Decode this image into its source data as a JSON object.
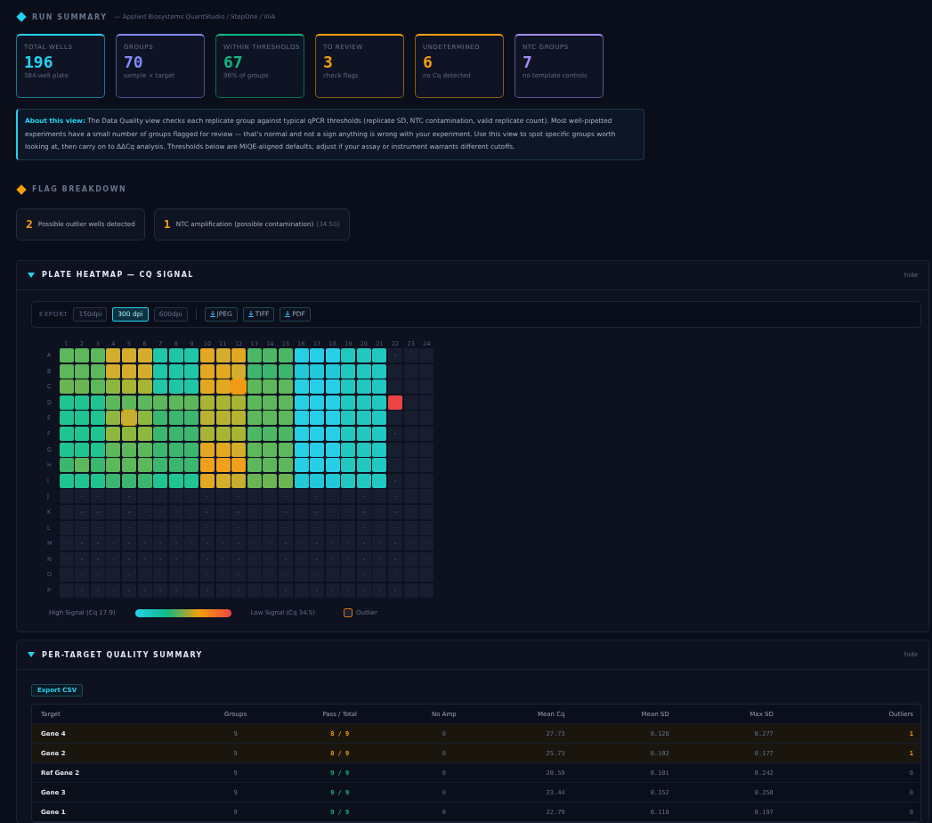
{
  "run_summary": {
    "title": "RUN SUMMARY",
    "subtitle": "— Applied Biosystems QuantStudio / StepOne / ViiA",
    "cards": [
      {
        "label": "TOTAL WELLS",
        "value": "196",
        "note": "384-well plate",
        "color": "#22d3ee"
      },
      {
        "label": "GROUPS",
        "value": "70",
        "note": "sample × target",
        "color": "#818cf8"
      },
      {
        "label": "WITHIN THRESHOLDS",
        "value": "67",
        "note": "96% of groups",
        "color": "#10b981"
      },
      {
        "label": "TO REVIEW",
        "value": "3",
        "note": "check flags",
        "color": "#f59e0b"
      },
      {
        "label": "UNDETERMINED",
        "value": "6",
        "note": "no Cq detected",
        "color": "#f59e0b"
      },
      {
        "label": "NTC GROUPS",
        "value": "7",
        "note": "no template controls",
        "color": "#a78bfa"
      }
    ],
    "about": "**About this view:** The Data Quality view checks each replicate group against typical qPCR thresholds (replicate SD, NTC contamination, valid replicate count). Most well-pipetted experiments have a small number of groups flagged for review — that's normal and not a sign anything is wrong with your experiment. Use this view to spot specific groups worth looking at, then carry on to ΔΔCq analysis. Thresholds below are MIQE-aligned defaults; adjust if your assay or instrument warrants different cutoffs."
  },
  "flag_breakdown": {
    "title": "FLAG BREAKDOWN",
    "flags": [
      {
        "count": "2",
        "text": "Possible outlier wells detected"
      },
      {
        "count": "1",
        "text": "NTC amplification (possible contamination)",
        "detail": "(34.50)"
      }
    ]
  },
  "heatmap": {
    "title": "PLATE HEATMAP — CQ SIGNAL",
    "toggle": "hide",
    "expanded": true,
    "export": {
      "label": "EXPORT",
      "resolutions": [
        {
          "label": "150dpi",
          "selected": false
        },
        {
          "label": "300 dpi",
          "selected": true
        },
        {
          "label": "600dpi",
          "selected": false
        }
      ],
      "formats": [
        "JPEG",
        "TIFF",
        "PDF"
      ]
    },
    "columns": [
      "1",
      "2",
      "3",
      "4",
      "5",
      "6",
      "7",
      "8",
      "9",
      "10",
      "11",
      "12",
      "13",
      "14",
      "15",
      "16",
      "17",
      "18",
      "19",
      "20",
      "21",
      "22",
      "23",
      "24"
    ],
    "rows": [
      {
        "label": "A",
        "wells": [
          {
            "color": "#5cb85a",
            "outlier": false
          },
          {
            "color": "#5cb85a",
            "outlier": false
          },
          {
            "color": "#5cb85a",
            "outlier": false
          },
          {
            "color": "#d4ad2c",
            "outlier": false
          },
          {
            "color": "#d4ad2c",
            "outlier": false
          },
          {
            "color": "#d4ad2c",
            "outlier": false
          },
          {
            "color": "#1fc7a8",
            "outlier": false
          },
          {
            "color": "#1fc7a8",
            "outlier": false
          },
          {
            "color": "#1fc7a8",
            "outlier": false
          },
          {
            "color": "#e3a822",
            "outlier": false
          },
          {
            "color": "#d4ad2c",
            "outlier": false
          },
          {
            "color": "#e3a822",
            "outlier": false
          },
          {
            "color": "#4cb866",
            "outlier": false
          },
          {
            "color": "#4cb866",
            "outlier": false
          },
          {
            "color": "#4cb866",
            "outlier": false
          },
          {
            "color": "#26cfe6",
            "outlier": false
          },
          {
            "color": "#26cfe6",
            "outlier": false
          },
          {
            "color": "#26cfe6",
            "outlier": false
          },
          {
            "color": "#20c8bf",
            "outlier": false
          },
          {
            "color": "#20c8bf",
            "outlier": false
          },
          {
            "color": "#20c8bf",
            "outlier": false
          }
        ]
      },
      {
        "label": "B",
        "wells": [
          {
            "color": "#5cb85a",
            "outlier": false
          },
          {
            "color": "#5cb85a",
            "outlier": false
          },
          {
            "color": "#5cb85a",
            "outlier": false
          },
          {
            "color": "#d4ad2c",
            "outlier": false
          },
          {
            "color": "#d4ad2c",
            "outlier": false
          },
          {
            "color": "#d4ad2c",
            "outlier": false
          },
          {
            "color": "#1fc7a8",
            "outlier": false
          },
          {
            "color": "#1fc7a8",
            "outlier": false
          },
          {
            "color": "#1fc7a8",
            "outlier": false
          },
          {
            "color": "#e3a822",
            "outlier": false
          },
          {
            "color": "#e3a822",
            "outlier": false
          },
          {
            "color": "#d4ad2c",
            "outlier": false
          },
          {
            "color": "#3cb56e",
            "outlier": false
          },
          {
            "color": "#3cb56e",
            "outlier": false
          },
          {
            "color": "#3cb56e",
            "outlier": false
          },
          {
            "color": "#20c8d8",
            "outlier": false
          },
          {
            "color": "#20c8d8",
            "outlier": false
          },
          {
            "color": "#20c8d8",
            "outlier": false
          },
          {
            "color": "#20c8bf",
            "outlier": false
          },
          {
            "color": "#20c8bf",
            "outlier": false
          },
          {
            "color": "#20c8bf",
            "outlier": false
          }
        ]
      },
      {
        "label": "C",
        "wells": [
          {
            "color": "#6ab552",
            "outlier": false
          },
          {
            "color": "#6ab552",
            "outlier": false
          },
          {
            "color": "#5cb85a",
            "outlier": false
          },
          {
            "color": "#8cb840",
            "outlier": false
          },
          {
            "color": "#a8b436",
            "outlier": false
          },
          {
            "color": "#a8b436",
            "outlier": false
          },
          {
            "color": "#1fc7a8",
            "outlier": false
          },
          {
            "color": "#1fc7a8",
            "outlier": false
          },
          {
            "color": "#1fc7a8",
            "outlier": false
          },
          {
            "color": "#e3a822",
            "outlier": false
          },
          {
            "color": "#e3a822",
            "outlier": false
          },
          {
            "color": "#f29a18",
            "outlier": true
          },
          {
            "color": "#5cb85a",
            "outlier": false
          },
          {
            "color": "#5cb85a",
            "outlier": false
          },
          {
            "color": "#5cb85a",
            "outlier": false
          },
          {
            "color": "#26cfe6",
            "outlier": false
          },
          {
            "color": "#26cfe6",
            "outlier": false
          },
          {
            "color": "#26cfe6",
            "outlier": false
          },
          {
            "color": "#20c8bf",
            "outlier": false
          },
          {
            "color": "#20c8bf",
            "outlier": false
          },
          {
            "color": "#20c8bf",
            "outlier": false
          }
        ]
      },
      {
        "label": "D",
        "wells": [
          {
            "color": "#1fc490",
            "outlier": false
          },
          {
            "color": "#1fc490",
            "outlier": false
          },
          {
            "color": "#1fc490",
            "outlier": false
          },
          {
            "color": "#5cb85a",
            "outlier": false
          },
          {
            "color": "#5cb85a",
            "outlier": false
          },
          {
            "color": "#5cb85a",
            "outlier": false
          },
          {
            "color": "#5cb85a",
            "outlier": false
          },
          {
            "color": "#5cb85a",
            "outlier": false
          },
          {
            "color": "#5cb85a",
            "outlier": false
          },
          {
            "color": "#a8b436",
            "outlier": false
          },
          {
            "color": "#a8b436",
            "outlier": false
          },
          {
            "color": "#a8b436",
            "outlier": false
          },
          {
            "color": "#5cb85a",
            "outlier": false
          },
          {
            "color": "#5cb85a",
            "outlier": false
          },
          {
            "color": "#5cb85a",
            "outlier": false
          },
          {
            "color": "#26cfe6",
            "outlier": false
          },
          {
            "color": "#26cfe6",
            "outlier": false
          },
          {
            "color": "#26cfe6",
            "outlier": false
          },
          {
            "color": "#20c8bf",
            "outlier": false
          },
          {
            "color": "#20c8bf",
            "outlier": false
          },
          {
            "color": "#20c8bf",
            "outlier": false
          },
          {
            "color": "#ef4444",
            "outlier": false
          }
        ]
      },
      {
        "label": "E",
        "wells": [
          {
            "color": "#1fc490",
            "outlier": false
          },
          {
            "color": "#1fc490",
            "outlier": false
          },
          {
            "color": "#1fc490",
            "outlier": false
          },
          {
            "color": "#8cb840",
            "outlier": false
          },
          {
            "color": "#c8ae2e",
            "outlier": true
          },
          {
            "color": "#8cb840",
            "outlier": false
          },
          {
            "color": "#3cb56e",
            "outlier": false
          },
          {
            "color": "#3cb56e",
            "outlier": false
          },
          {
            "color": "#3cb56e",
            "outlier": false
          },
          {
            "color": "#b8b232",
            "outlier": false
          },
          {
            "color": "#b8b232",
            "outlier": false
          },
          {
            "color": "#b8b232",
            "outlier": false
          },
          {
            "color": "#5cb85a",
            "outlier": false
          },
          {
            "color": "#5cb85a",
            "outlier": false
          },
          {
            "color": "#5cb85a",
            "outlier": false
          },
          {
            "color": "#26cfe6",
            "outlier": false
          },
          {
            "color": "#26cfe6",
            "outlier": false
          },
          {
            "color": "#26cfe6",
            "outlier": false
          },
          {
            "color": "#20c8bf",
            "outlier": false
          },
          {
            "color": "#20c8bf",
            "outlier": false
          },
          {
            "color": "#20c8bf",
            "outlier": false
          }
        ]
      },
      {
        "label": "F",
        "wells": [
          {
            "color": "#1fc490",
            "outlier": false
          },
          {
            "color": "#1fc490",
            "outlier": false
          },
          {
            "color": "#1fc490",
            "outlier": false
          },
          {
            "color": "#8cb840",
            "outlier": false
          },
          {
            "color": "#8cb840",
            "outlier": false
          },
          {
            "color": "#8cb840",
            "outlier": false
          },
          {
            "color": "#3cb56e",
            "outlier": false
          },
          {
            "color": "#3cb56e",
            "outlier": false
          },
          {
            "color": "#3cb56e",
            "outlier": false
          },
          {
            "color": "#a8b436",
            "outlier": false
          },
          {
            "color": "#a8b436",
            "outlier": false
          },
          {
            "color": "#a8b436",
            "outlier": false
          },
          {
            "color": "#4cb866",
            "outlier": false
          },
          {
            "color": "#4cb866",
            "outlier": false
          },
          {
            "color": "#4cb866",
            "outlier": false
          },
          {
            "color": "#26cfe6",
            "outlier": false
          },
          {
            "color": "#26cfe6",
            "outlier": false
          },
          {
            "color": "#26cfe6",
            "outlier": false
          },
          {
            "color": "#20c8bf",
            "outlier": false
          },
          {
            "color": "#20c8bf",
            "outlier": false
          },
          {
            "color": "#20c8bf",
            "outlier": false
          }
        ]
      },
      {
        "label": "G",
        "wells": [
          {
            "color": "#1fc490",
            "outlier": false
          },
          {
            "color": "#1fc490",
            "outlier": false
          },
          {
            "color": "#1fc490",
            "outlier": false
          },
          {
            "color": "#5cb85a",
            "outlier": false
          },
          {
            "color": "#5cb85a",
            "outlier": false
          },
          {
            "color": "#5cb85a",
            "outlier": false
          },
          {
            "color": "#3cb56e",
            "outlier": false
          },
          {
            "color": "#3cb56e",
            "outlier": false
          },
          {
            "color": "#3cb56e",
            "outlier": false
          },
          {
            "color": "#e3a822",
            "outlier": false
          },
          {
            "color": "#e3a822",
            "outlier": false
          },
          {
            "color": "#d4ad2c",
            "outlier": false
          },
          {
            "color": "#5cb85a",
            "outlier": false
          },
          {
            "color": "#5cb85a",
            "outlier": false
          },
          {
            "color": "#5cb85a",
            "outlier": false
          },
          {
            "color": "#26cfe6",
            "outlier": false
          },
          {
            "color": "#26cfe6",
            "outlier": false
          },
          {
            "color": "#26cfe6",
            "outlier": false
          },
          {
            "color": "#20c8bf",
            "outlier": false
          },
          {
            "color": "#20c8bf",
            "outlier": false
          },
          {
            "color": "#20c8bf",
            "outlier": false
          }
        ]
      },
      {
        "label": "H",
        "wells": [
          {
            "color": "#3cb56e",
            "outlier": false
          },
          {
            "color": "#5cb85a",
            "outlier": false
          },
          {
            "color": "#3cb56e",
            "outlier": false
          },
          {
            "color": "#5cb85a",
            "outlier": false
          },
          {
            "color": "#5cb85a",
            "outlier": false
          },
          {
            "color": "#5cb85a",
            "outlier": false
          },
          {
            "color": "#3cb56e",
            "outlier": false
          },
          {
            "color": "#3cb56e",
            "outlier": false
          },
          {
            "color": "#3cb56e",
            "outlier": false
          },
          {
            "color": "#f0a01c",
            "outlier": false
          },
          {
            "color": "#f0a01c",
            "outlier": false
          },
          {
            "color": "#f0a01c",
            "outlier": false
          },
          {
            "color": "#5cb85a",
            "outlier": false
          },
          {
            "color": "#5cb85a",
            "outlier": false
          },
          {
            "color": "#5cb85a",
            "outlier": false
          },
          {
            "color": "#26cfe6",
            "outlier": false
          },
          {
            "color": "#26cfe6",
            "outlier": false
          },
          {
            "color": "#26cfe6",
            "outlier": false
          },
          {
            "color": "#20c8bf",
            "outlier": false
          },
          {
            "color": "#20c8bf",
            "outlier": false
          },
          {
            "color": "#20c8bf",
            "outlier": false
          }
        ]
      },
      {
        "label": "I",
        "wells": [
          {
            "color": "#1fc490",
            "outlier": false
          },
          {
            "color": "#1fc490",
            "outlier": false
          },
          {
            "color": "#1fc490",
            "outlier": false
          },
          {
            "color": "#3cb56e",
            "outlier": false
          },
          {
            "color": "#3cb56e",
            "outlier": false
          },
          {
            "color": "#3cb56e",
            "outlier": false
          },
          {
            "color": "#1fc490",
            "outlier": false
          },
          {
            "color": "#1fc490",
            "outlier": false
          },
          {
            "color": "#1fc490",
            "outlier": false
          },
          {
            "color": "#e3a822",
            "outlier": false
          },
          {
            "color": "#d4ad2c",
            "outlier": false
          },
          {
            "color": "#c8ae2e",
            "outlier": false
          },
          {
            "color": "#6ab552",
            "outlier": false
          },
          {
            "color": "#6ab552",
            "outlier": false
          },
          {
            "color": "#6ab552",
            "outlier": false
          },
          {
            "color": "#20c8d8",
            "outlier": false
          },
          {
            "color": "#20c8d8",
            "outlier": false
          },
          {
            "color": "#20c8d8",
            "outlier": false
          },
          {
            "color": "#20c8bf",
            "outlier": false
          },
          {
            "color": "#20c8bf",
            "outlier": false
          },
          {
            "color": "#20c8bf",
            "outlier": false
          }
        ]
      },
      {
        "label": "J"
      },
      {
        "label": "K"
      },
      {
        "label": "L"
      },
      {
        "label": "M"
      },
      {
        "label": "N"
      },
      {
        "label": "O"
      },
      {
        "label": "P"
      }
    ],
    "legend": {
      "high": "High Signal (Cq 17.9)",
      "low": "Low Signal (Cq 34.5)",
      "outlier": "Outlier"
    }
  },
  "quality_summary": {
    "title": "PER-TARGET QUALITY SUMMARY",
    "toggle": "hide",
    "expanded": true,
    "export_button": "Export CSV",
    "columns": [
      "Target",
      "Groups",
      "Pass / Total",
      "No Amp",
      "Mean Cq",
      "Mean SD",
      "Max SD",
      "Outliers"
    ],
    "rows": [
      {
        "target": "Gene 4",
        "groups": "9",
        "pass": "8 / 9",
        "no_amp": "0",
        "mean_cq": "27.73",
        "mean_sd": "0.128",
        "max_sd": "0.277",
        "outliers": "1",
        "flagged": true
      },
      {
        "target": "Gene 2",
        "groups": "9",
        "pass": "8 / 9",
        "no_amp": "0",
        "mean_cq": "25.73",
        "mean_sd": "0.102",
        "max_sd": "0.177",
        "outliers": "1",
        "flagged": true
      },
      {
        "target": "Ref Gene 2",
        "groups": "9",
        "pass": "9 / 9",
        "no_amp": "0",
        "mean_cq": "20.59",
        "mean_sd": "0.101",
        "max_sd": "0.242",
        "outliers": "0",
        "flagged": false
      },
      {
        "target": "Gene 3",
        "groups": "9",
        "pass": "9 / 9",
        "no_amp": "0",
        "mean_cq": "23.44",
        "mean_sd": "0.152",
        "max_sd": "0.258",
        "outliers": "0",
        "flagged": false
      },
      {
        "target": "Gene 1",
        "groups": "9",
        "pass": "9 / 9",
        "no_amp": "0",
        "mean_cq": "22.79",
        "mean_sd": "0.118",
        "max_sd": "0.197",
        "outliers": "0",
        "flagged": false
      }
    ]
  }
}
